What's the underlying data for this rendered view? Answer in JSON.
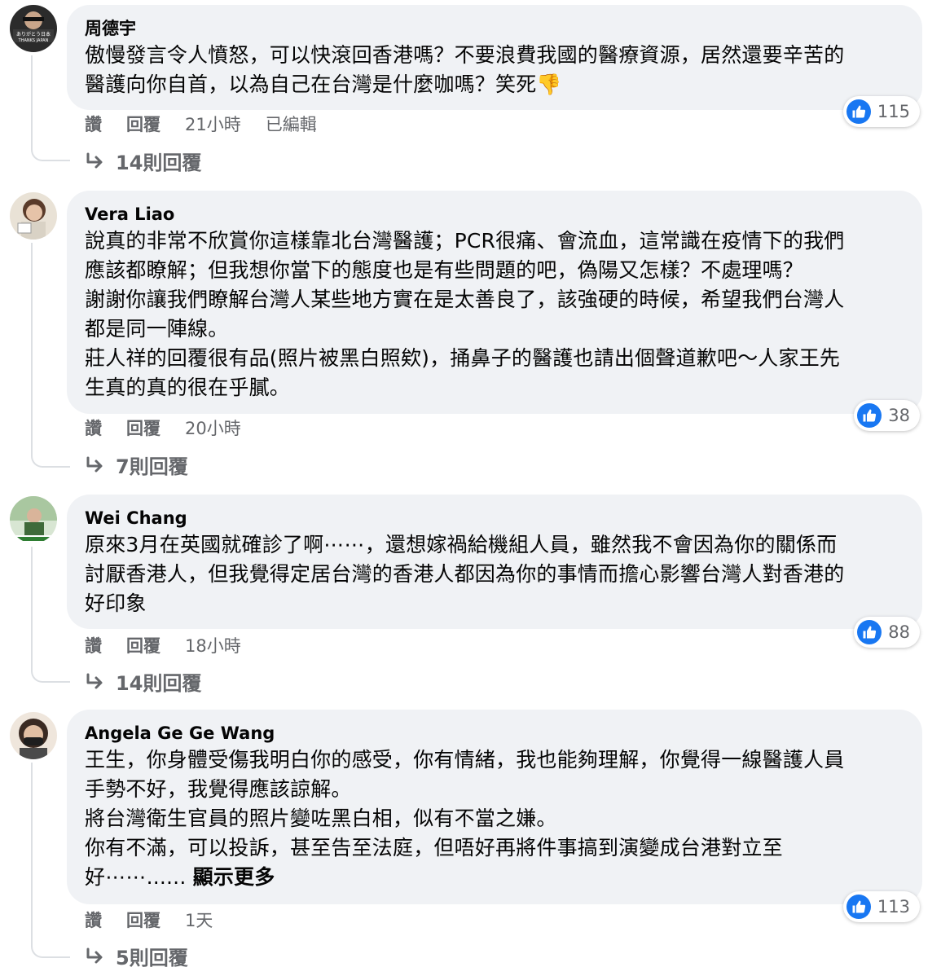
{
  "comments": [
    {
      "author": "周德宇",
      "text": "傲慢發言令人憤怒，可以快滾回香港嗎？不要浪費我國的醫療資源，居然還要辛苦的\n醫護向你自首，以為自己在台灣是什麼咖嗎？笑死",
      "emoji": "👎",
      "like_label": "讚",
      "reply_label": "回覆",
      "time": "21小時",
      "edited": "已編輯",
      "reaction_count": "115",
      "replies": "14則回覆",
      "avatar_text_1": "ありがとう日本",
      "avatar_text_2": "THANKS JAPAN"
    },
    {
      "author": "Vera Liao",
      "text": "說真的非常不欣賞你這樣靠北台灣醫護；PCR很痛、會流血，這常識在疫情下的我們\n應該都瞭解；但我想你當下的態度也是有些問題的吧，偽陽又怎樣？不處理嗎？\n謝謝你讓我們瞭解台灣人某些地方實在是太善良了，該強硬的時候，希望我們台灣人\n都是同一陣線。\n莊人祥的回覆很有品(照片被黑白照欸)，捅鼻子的醫護也請出個聲道歉吧～人家王先\n生真的真的很在乎膩。",
      "like_label": "讚",
      "reply_label": "回覆",
      "time": "20小時",
      "reaction_count": "38",
      "replies": "7則回覆"
    },
    {
      "author": "Wei Chang",
      "text": "原來3月在英國就確診了啊⋯⋯，還想嫁禍給機組人員，雖然我不會因為你的關係而\n討厭香港人，但我覺得定居台灣的香港人都因為你的事情而擔心影響台灣人對香港的\n好印象",
      "like_label": "讚",
      "reply_label": "回覆",
      "time": "18小時",
      "reaction_count": "88",
      "replies": "14則回覆"
    },
    {
      "author": "Angela Ge Ge Wang",
      "text": "王生，你身體受傷我明白你的感受，你有情緒，我也能夠理解，你覺得一線醫護人員\n手勢不好，我覺得應該諒解。\n將台灣衛生官員的照片變咗黑白相，似有不當之嫌。\n你有不滿，可以投訴，甚至告至法庭，但唔好再將件事搞到演變成台港對立至\n好⋯⋯...... ",
      "see_more": "顯示更多",
      "like_label": "讚",
      "reply_label": "回覆",
      "time": "1天",
      "reaction_count": "113",
      "replies": "5則回覆"
    }
  ]
}
